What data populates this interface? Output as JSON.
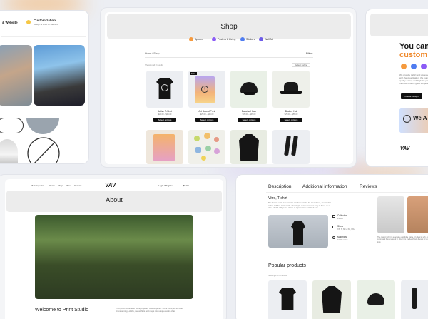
{
  "colors": {
    "accent_orange": "#f59a3e",
    "accent_purple": "#8b5cf6",
    "accent_blue": "#4f7cf0",
    "dark": "#111111",
    "page_bg": "#eceef3"
  },
  "top_left": {
    "feature1": "& Website",
    "feature2_title": "Customization",
    "feature2_desc": "Design & Print on demand"
  },
  "shop": {
    "title": "Shop",
    "categories": [
      "Apparel",
      "Posters & Living",
      "Stickers",
      "Wall Art"
    ],
    "breadcrumb": "Home / Shop",
    "filters_label": "Filters",
    "results_label": "Showing all 8 results",
    "sort_label": "Default sorting",
    "products": [
      {
        "name": "Active T-Shirt",
        "price": "$25.00 – $35.00",
        "button": "Select options"
      },
      {
        "name": "Art Bound Print",
        "price": "$25.00 – $35.00",
        "button": "Select options",
        "badge": "Sale"
      },
      {
        "name": "Baseball Cap",
        "price": "$35.00 – $45.00",
        "button": "Select options"
      },
      {
        "name": "Bucket Hat",
        "price": "$25.00 – $55.00",
        "button": "Select options"
      }
    ]
  },
  "right_top": {
    "heading_line1": "You can c",
    "heading_line2": "custom d",
    "desc": "We proudly t-shirt and accessories with the visualisation, the numbers fine quality cutting and high the printing methods ensure great longevity.",
    "button": "Create Design",
    "banner_text": "We A",
    "logo": "VAV"
  },
  "about": {
    "nav": [
      "All Categories",
      "Home",
      "Shop",
      "About",
      "Contact"
    ],
    "logo": "VAV",
    "login": "Login / Register",
    "cart": "$0.00",
    "title": "About",
    "welcome": "Welcome to Print Studio",
    "welcome_body": "You go-to destination for high-quality custom prints. Since 2018, we've been transforming t-shirts, sweatshirts and mugs into unique works of art"
  },
  "product_detail": {
    "tabs": [
      "Description",
      "Additional information",
      "Reviews"
    ],
    "product_title": "Vitro, T-shirt",
    "description": "The classic t-shirt is a versatile wardrobe staple. It's ideal of soft, comfortable cotton and has a relaxed fit. The simple design makes it easy to dress up or down. Pair it with jeans, shorts or a jacket for a polished look.",
    "specs": [
      {
        "label": "Collection",
        "value": "Pocket"
      },
      {
        "label": "Sizes",
        "value": "XS, S, M, L, XL, XXL"
      },
      {
        "label": "Materials",
        "value": "100% cotton"
      }
    ],
    "side_text": "The classic t-shirt is a versatile wardrobe staple. It's ideal of soft, comfortable cotton and has a relaxed fit. Wear it to the beach with friends for a casual look.",
    "popular_title": "Popular products",
    "popular_sub": "Showing 1–4 of 8 results"
  }
}
